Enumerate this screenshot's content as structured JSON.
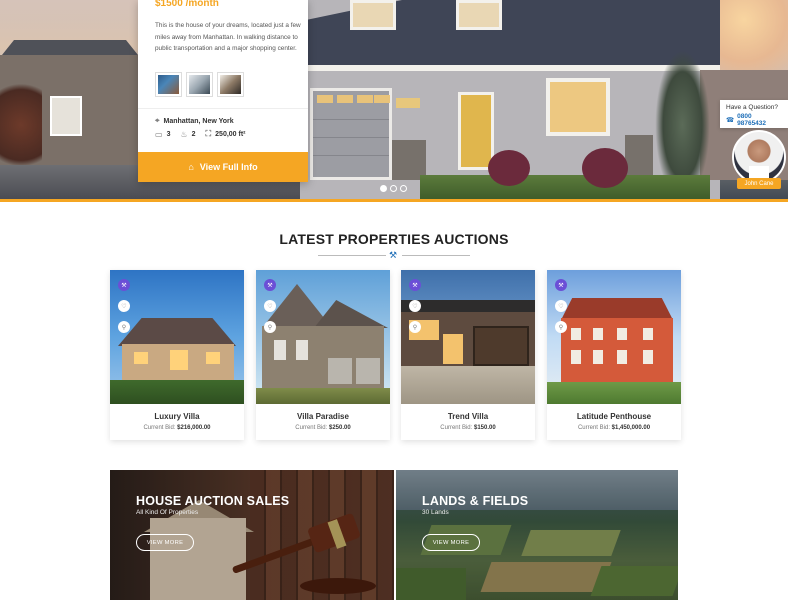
{
  "hero": {
    "property": {
      "price": "$1500 /month",
      "description": "This is the house of your dreams, located just a few miles away from Manhattan. In walking distance to public transportation and a major shopping center.",
      "location": "Manhattan, New York",
      "bedrooms": "3",
      "bathrooms": "2",
      "area": "250,00 ft²",
      "view_button": "View Full Info"
    },
    "slider_dots": 3,
    "contact": {
      "title": "Have a Question?",
      "phone": "0800 98765432",
      "agent_name": "John Cane"
    }
  },
  "auctions": {
    "title": "LATEST PROPERTIES AUCTIONS",
    "bid_label": "Current Bid:",
    "items": [
      {
        "name": "Luxury Villa",
        "bid": "$216,000.00"
      },
      {
        "name": "Villa Paradise",
        "bid": "$250.00"
      },
      {
        "name": "Trend Villa",
        "bid": "$150.00"
      },
      {
        "name": "Latitude Penthouse",
        "bid": "$1,450,000.00"
      }
    ]
  },
  "banners": [
    {
      "title": "HOUSE AUCTION SALES",
      "subtitle": "All Kind Of Properties",
      "button": "VIEW MORE"
    },
    {
      "title": "LANDS & FIELDS",
      "subtitle": "30 Lands",
      "button": "VIEW MORE"
    }
  ],
  "colors": {
    "accent": "#f5a623",
    "link": "#1f6fb8",
    "badge": "#6b4fd6"
  }
}
